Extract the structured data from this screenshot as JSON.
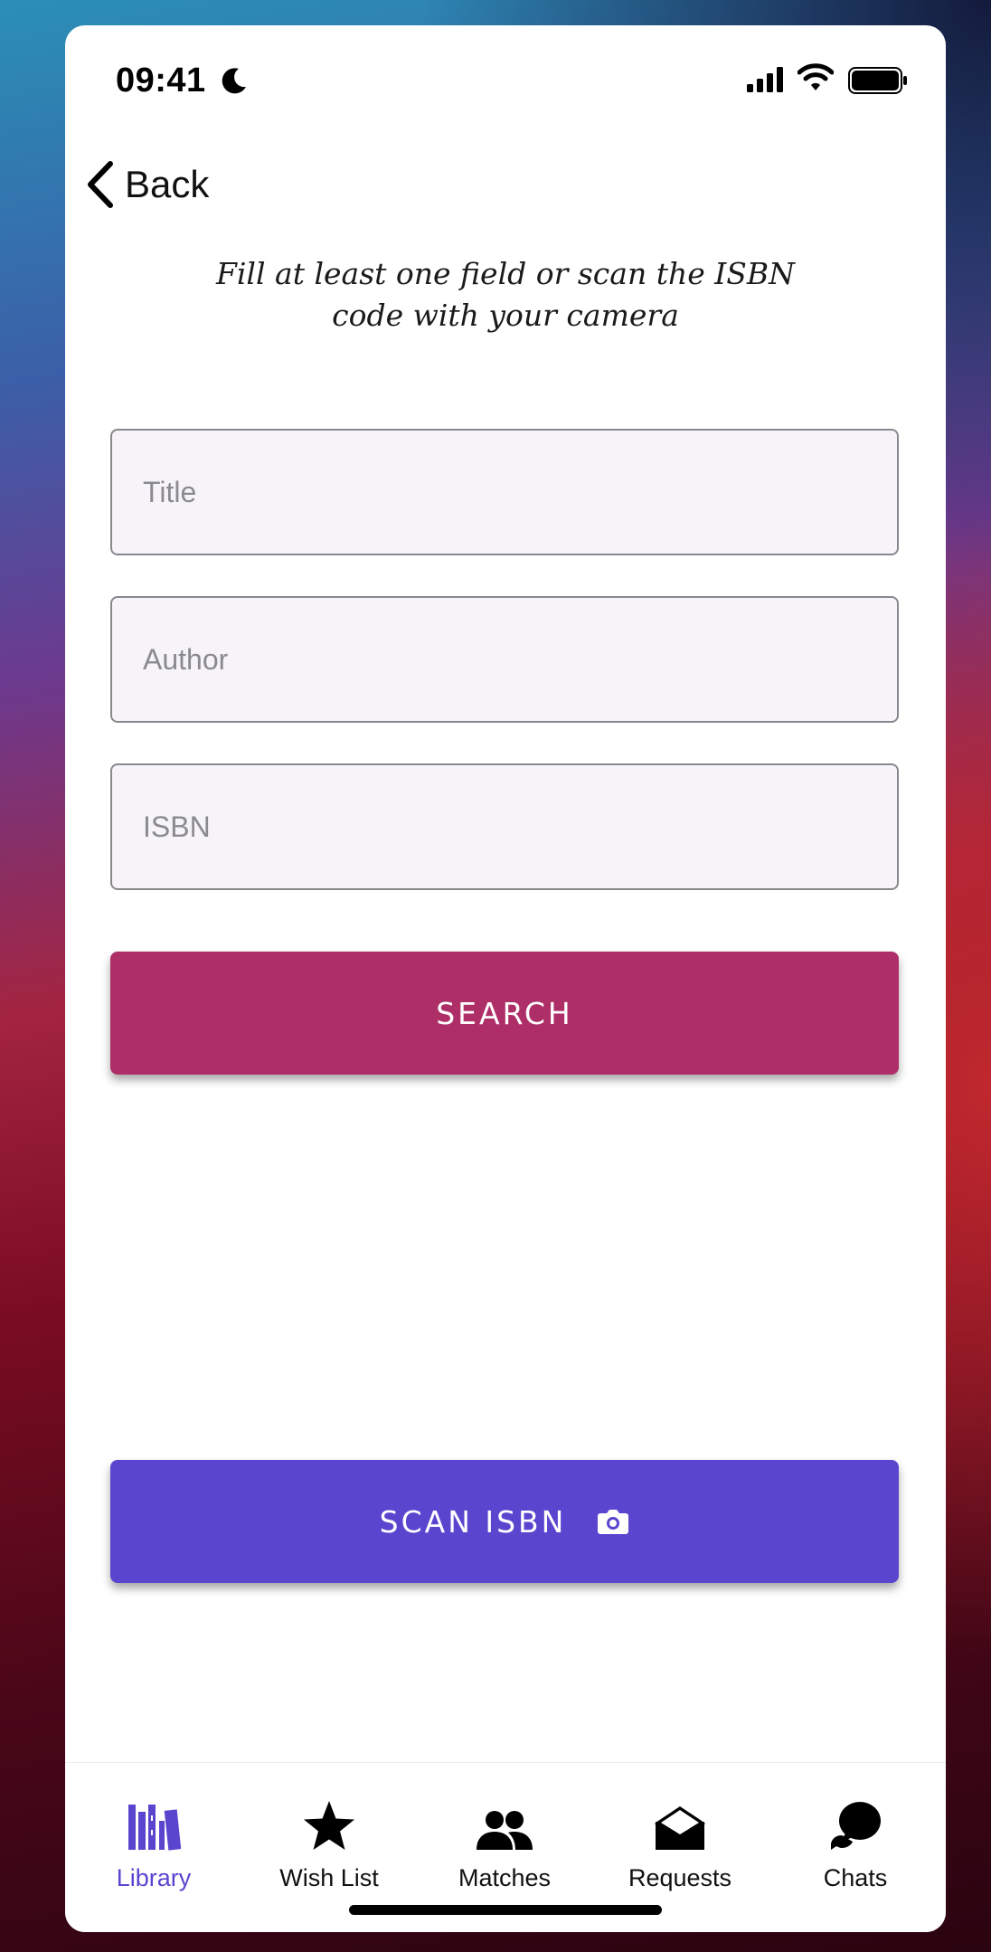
{
  "status_bar": {
    "time": "09:41"
  },
  "nav": {
    "back_label": "Back"
  },
  "instructions": {
    "line1": "Fill at least one field or scan the ISBN",
    "line2": "code with your camera"
  },
  "form": {
    "title_placeholder": "Title",
    "author_placeholder": "Author",
    "isbn_placeholder": "ISBN"
  },
  "buttons": {
    "search_label": "SEARCH",
    "scan_label": "SCAN ISBN"
  },
  "tabbar": {
    "items": [
      {
        "label": "Library",
        "icon": "library-icon",
        "active": true
      },
      {
        "label": "Wish List",
        "icon": "star-icon",
        "active": false
      },
      {
        "label": "Matches",
        "icon": "people-icon",
        "active": false
      },
      {
        "label": "Requests",
        "icon": "envelope-open-icon",
        "active": false
      },
      {
        "label": "Chats",
        "icon": "chat-bubbles-icon",
        "active": false
      }
    ]
  },
  "colors": {
    "accent_primary": "#5a45cf",
    "accent_search": "#ae2f68"
  }
}
